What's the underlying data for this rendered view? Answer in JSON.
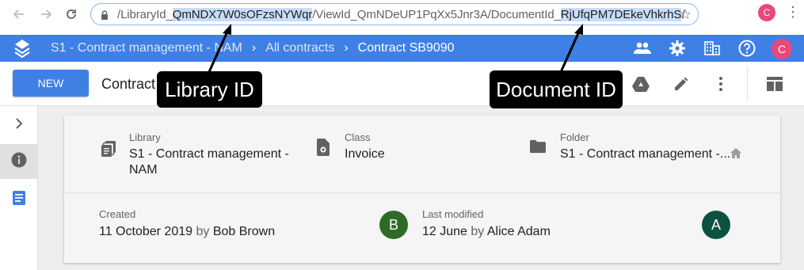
{
  "browser": {
    "url_prefix": "/LibraryId_",
    "url_library_id": "QmNDX7W0sOFzsNYWqr",
    "url_middle": "/ViewId_QmNDeUP1PqXx5Jnr3A/DocumentId_",
    "url_document_id": "RjUfqPM7DEkeVhkrhS",
    "url_suffix": "/",
    "profile_initial": "C"
  },
  "appbar": {
    "breadcrumbs": [
      "S1 - Contract management - NAM",
      "All contracts",
      "Contract SB9090"
    ],
    "avatar_initial": "C",
    "accent": "#3f80e4"
  },
  "toolbar": {
    "new_label": "NEW",
    "title": "Contract SB9090"
  },
  "details": {
    "library_label": "Library",
    "library_value_line1": "S1 - Contract management -",
    "library_value_line2": "NAM",
    "class_label": "Class",
    "class_value": "Invoice",
    "folder_label": "Folder",
    "folder_value": "S1 - Contract management -..."
  },
  "audit": {
    "created_label": "Created",
    "created_date": "11 October 2019",
    "by": "by",
    "created_by": "Bob Brown",
    "created_avatar": "B",
    "created_avatar_color": "#2e6b27",
    "modified_label": "Last modified",
    "modified_date": "12 June",
    "modified_by": "Alice Adam",
    "modified_avatar": "A",
    "modified_avatar_color": "#0b5340"
  },
  "annotations": {
    "library_callout": "Library ID",
    "document_callout": "Document ID"
  }
}
